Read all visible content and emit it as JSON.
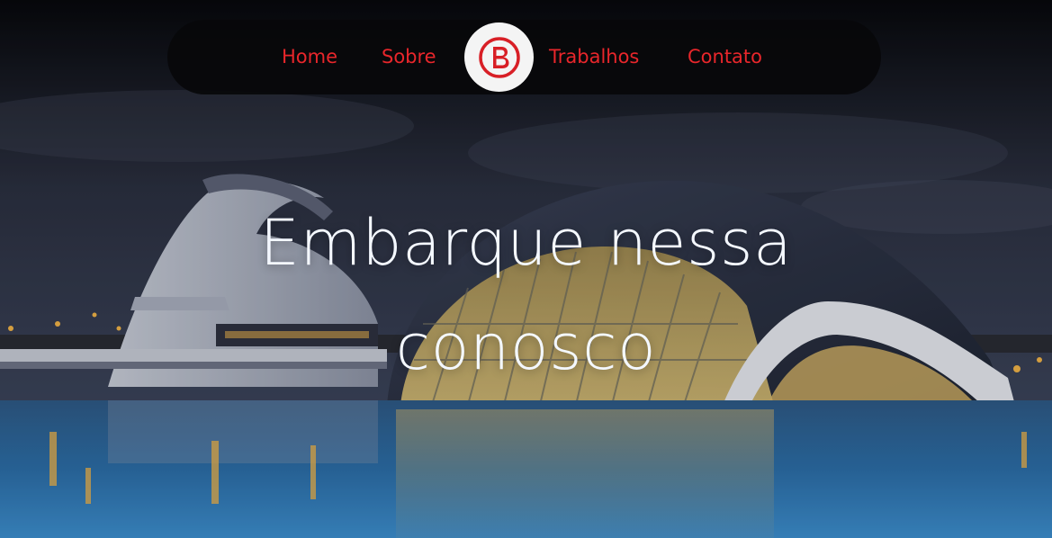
{
  "nav": {
    "items": [
      {
        "label": "Home"
      },
      {
        "label": "Sobre"
      },
      {
        "label": "Trabalhos"
      },
      {
        "label": "Contato"
      }
    ],
    "logo_icon": "b-letter-logo-icon"
  },
  "hero": {
    "headline_line1": "Embarque nessa",
    "headline_line2": "conosco",
    "background_image": "city-of-arts-and-sciences-night-photo"
  },
  "colors": {
    "accent": "#e8262b",
    "nav_bg": "#08080a",
    "headline": "#f4f8ff",
    "logo_bg": "#f4f4f4"
  }
}
